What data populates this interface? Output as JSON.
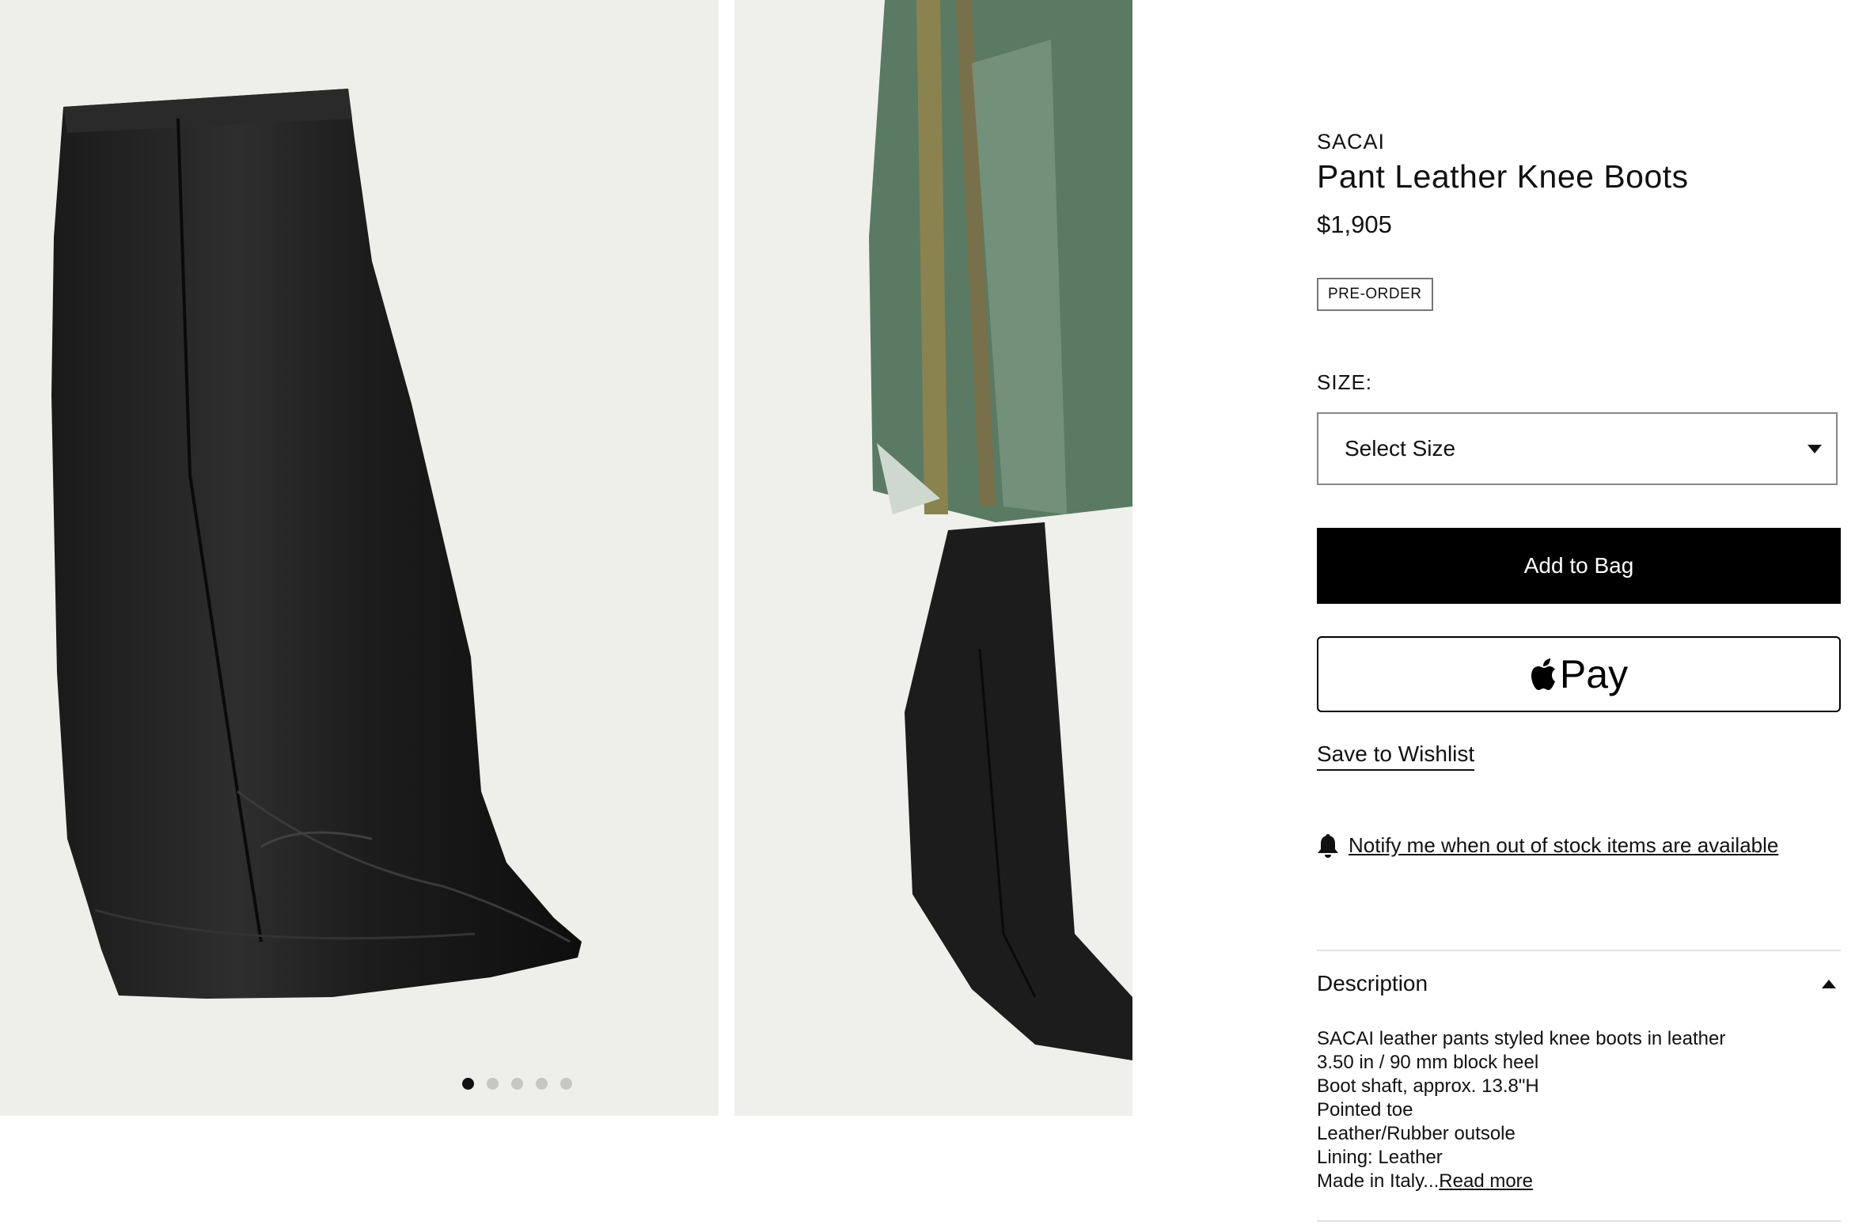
{
  "gallery": {
    "dot_count": 5,
    "active_dot": 1,
    "next_icon": "chevron-right-icon",
    "background_color": "#efefea"
  },
  "product": {
    "brand": "SACAI",
    "title": "Pant Leather Knee Boots",
    "price": "$1,905",
    "badge": "PRE-ORDER"
  },
  "size": {
    "label": "SIZE:",
    "selected": "Select Size"
  },
  "actions": {
    "add_to_bag": "Add to Bag",
    "apple_pay": "Pay",
    "wishlist": "Save to Wishlist",
    "notify": "Notify me when out of stock items are available"
  },
  "description": {
    "heading": "Description",
    "lines": [
      "SACAI leather pants styled knee boots in leather",
      "3.50 in / 90 mm block heel",
      "Boot shaft, approx. 13.8\"H",
      "Pointed toe",
      "Leather/Rubber outsole",
      "Lining: Leather"
    ],
    "last_line": "Made in Italy...",
    "read_more": "Read more"
  }
}
